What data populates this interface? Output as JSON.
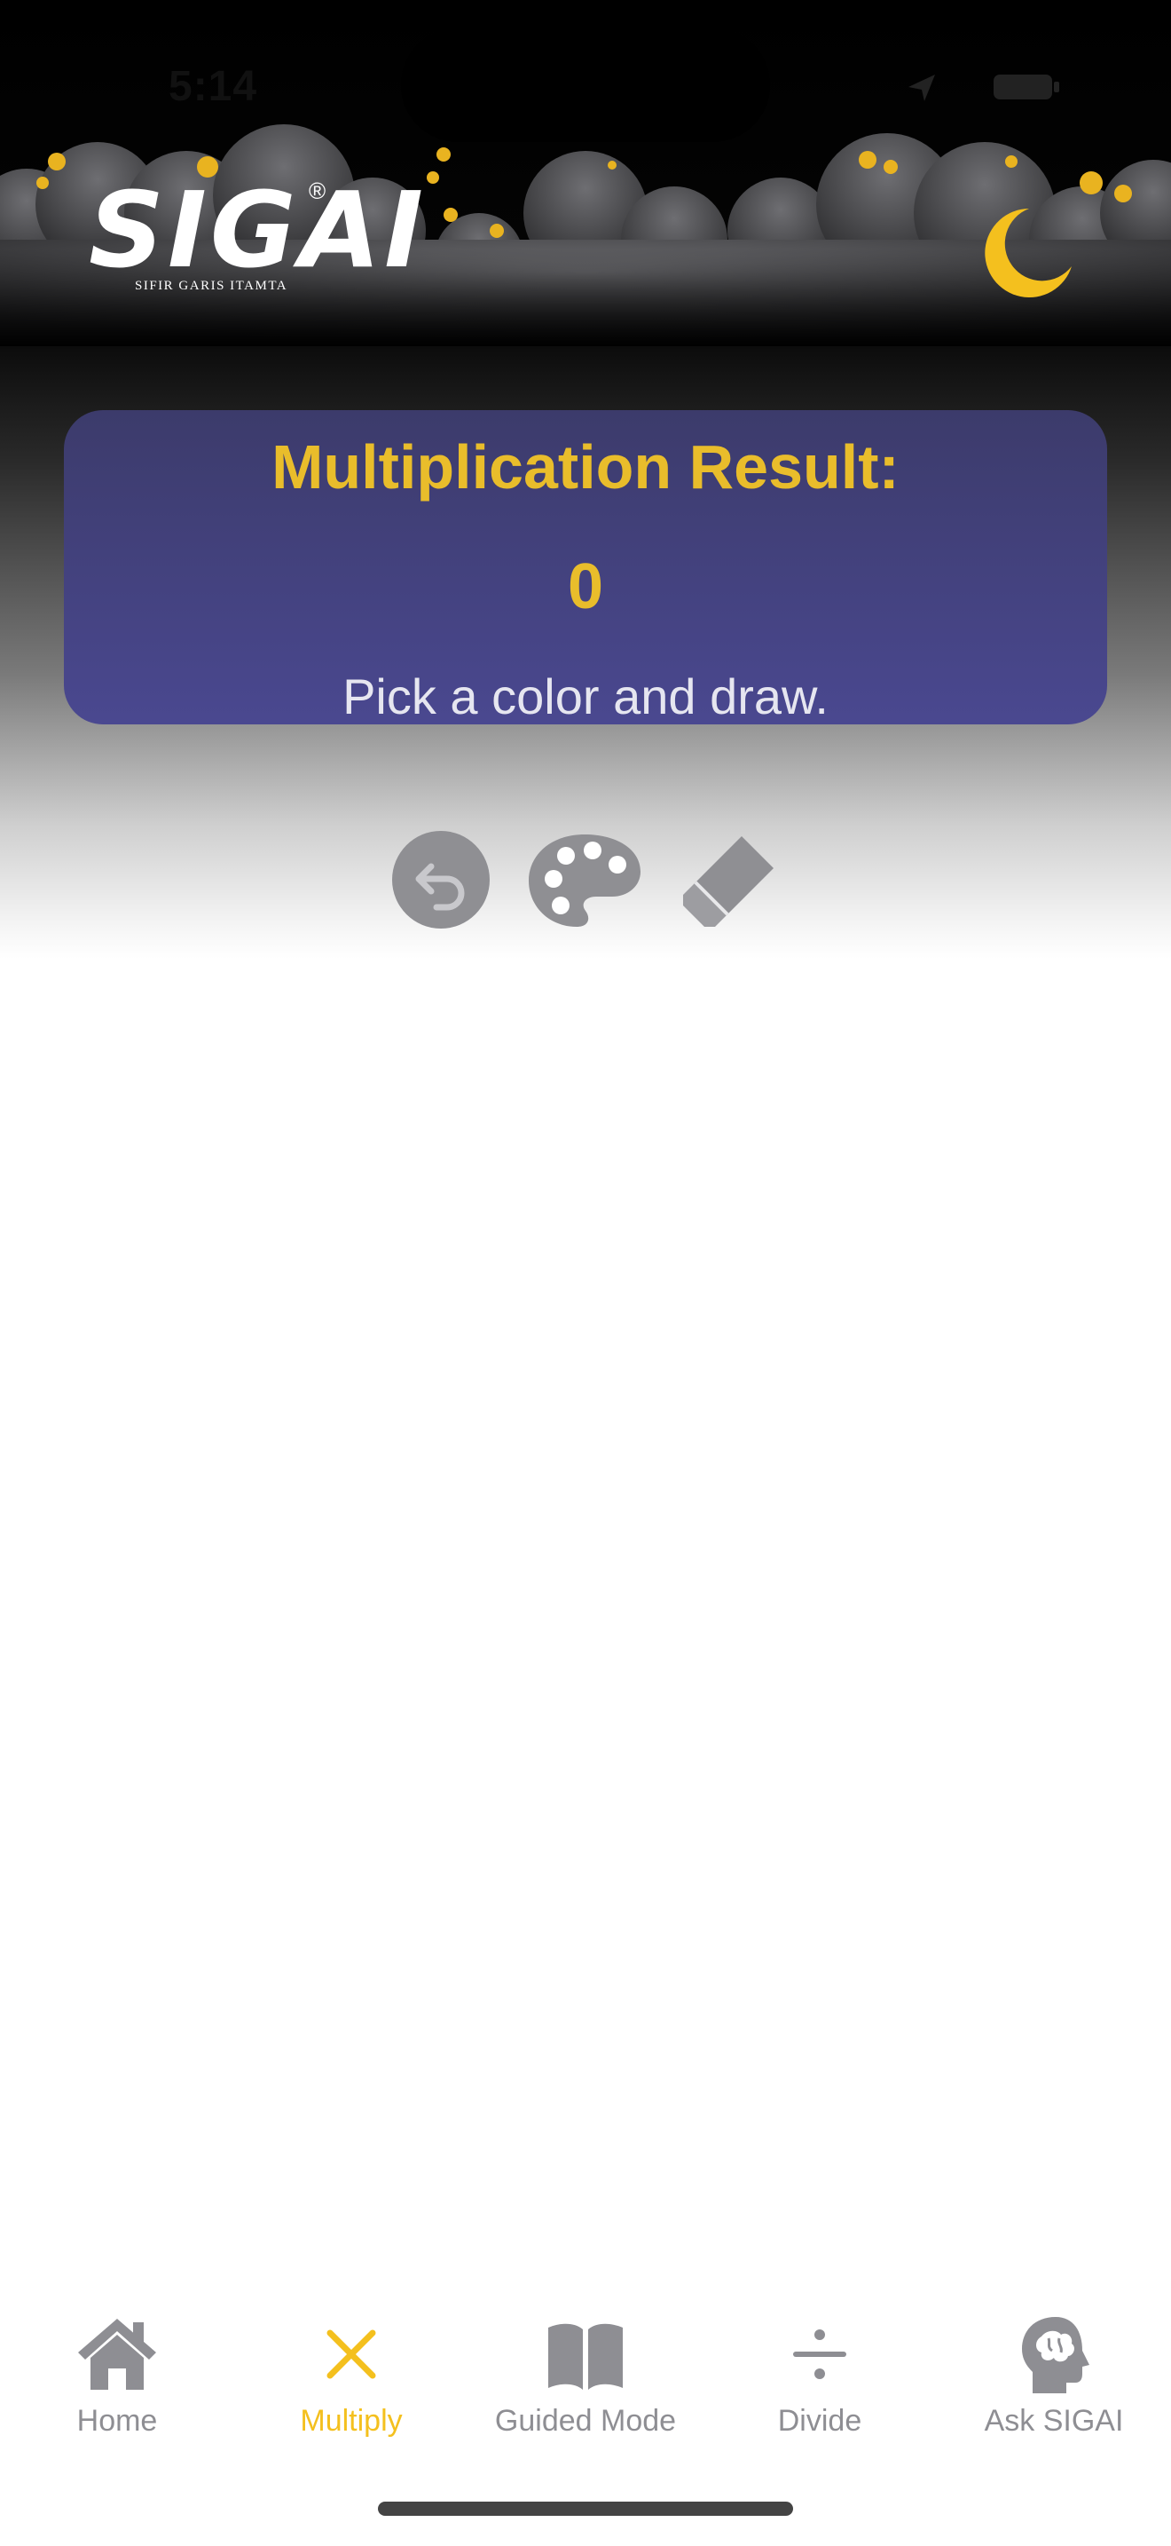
{
  "status_bar": {
    "time": "5:14"
  },
  "logo": {
    "name": "SIGAI",
    "registered": "®",
    "subtitle": "SIFIR GARIS ITAMTA"
  },
  "result_card": {
    "title": "Multiplication Result:",
    "value": "0",
    "hint": "Pick a color and draw."
  },
  "toolbar": {
    "undo_icon": "undo-icon",
    "palette_icon": "palette-icon",
    "eraser_icon": "eraser-icon"
  },
  "tabs": [
    {
      "label": "Home",
      "icon": "house-icon",
      "active": false
    },
    {
      "label": "Multiply",
      "icon": "multiply-icon",
      "active": true
    },
    {
      "label": "Guided Mode",
      "icon": "book-icon",
      "active": false
    },
    {
      "label": "Divide",
      "icon": "divide-icon",
      "active": false
    },
    {
      "label": "Ask SIGAI",
      "icon": "brain-head-icon",
      "active": false
    }
  ],
  "colors": {
    "accent": "#f4c01e",
    "card_top": "#3c3b6b",
    "card_bottom": "#4a4890",
    "inactive": "#8e8e93"
  }
}
